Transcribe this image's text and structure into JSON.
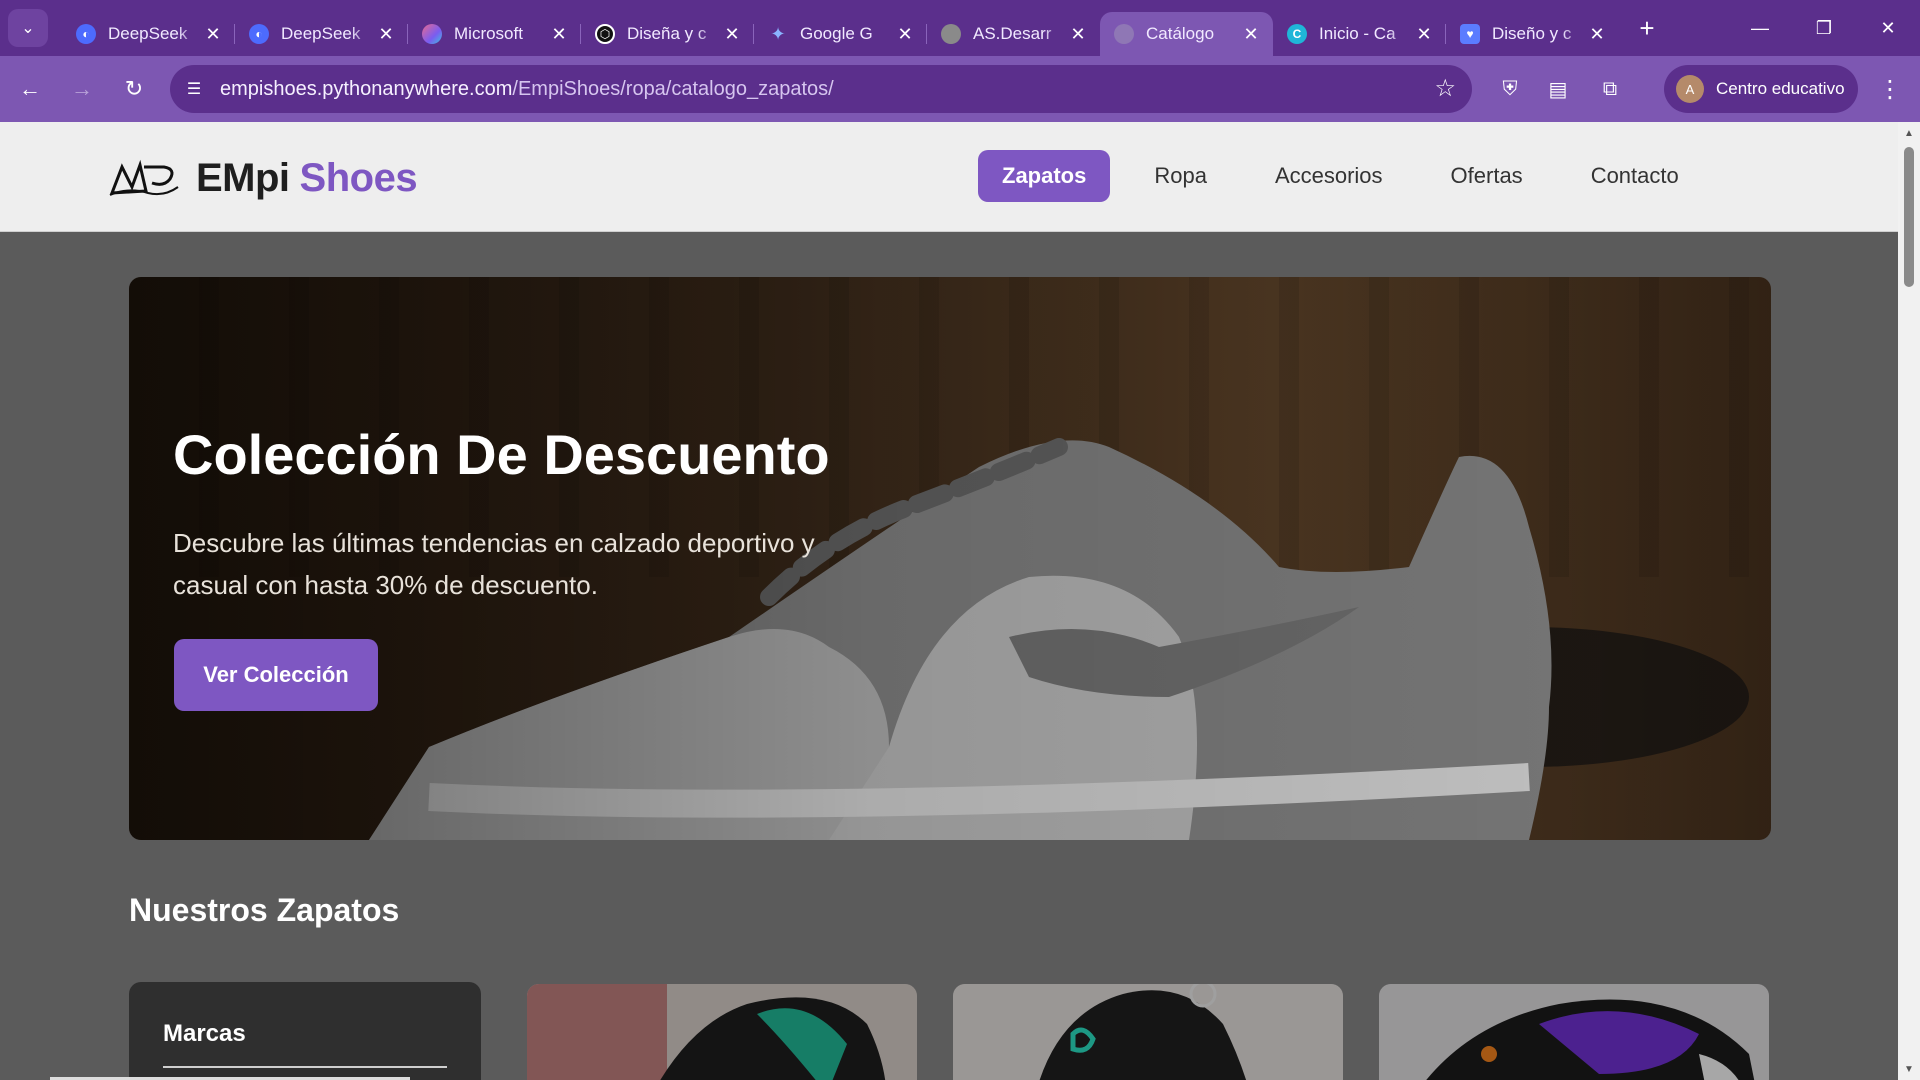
{
  "browser": {
    "tabs": [
      {
        "title": "DeepSeek",
        "favicon": "deepseek-icon",
        "color": "#4d6bfe"
      },
      {
        "title": "DeepSeek",
        "favicon": "deepseek-icon",
        "color": "#4d6bfe"
      },
      {
        "title": "Microsoft",
        "favicon": "copilot-icon",
        "color": "#e86a8f"
      },
      {
        "title": "Diseña y c",
        "favicon": "openai-icon",
        "color": "#111111"
      },
      {
        "title": "Google G",
        "favicon": "gemini-icon",
        "color": "#4a8df8"
      },
      {
        "title": "AS.Desarr",
        "favicon": "globe-icon",
        "color": "#777777"
      },
      {
        "title": "Catálogo",
        "favicon": "globe-icon",
        "color": "#8f77b5",
        "active": true
      },
      {
        "title": "Inicio - Ca",
        "favicon": "canva-icon",
        "color": "#1fb6d8"
      },
      {
        "title": "Diseño y c",
        "favicon": "shield-icon",
        "color": "#5b7cff"
      }
    ],
    "url_host": "empishoes.pythonanywhere.com",
    "url_path": "/EmpiShoes/ropa/catalogo_zapatos/",
    "profile_initial": "A",
    "profile_label": "Centro educativo"
  },
  "site": {
    "logo_main": "EMpi",
    "logo_accent": "Shoes",
    "nav": [
      {
        "label": "Zapatos",
        "active": true
      },
      {
        "label": "Ropa"
      },
      {
        "label": "Accesorios"
      },
      {
        "label": "Ofertas"
      },
      {
        "label": "Contacto"
      }
    ],
    "accent_color": "#7e57c2"
  },
  "hero": {
    "title": "Colección De Descuento",
    "subtitle": "Descubre las últimas tendencias en calzado deportivo y casual con hasta 30% de descuento.",
    "button": "Ver Colección"
  },
  "catalog": {
    "section_title": "Nuestros Zapatos",
    "filter_title": "Marcas"
  }
}
